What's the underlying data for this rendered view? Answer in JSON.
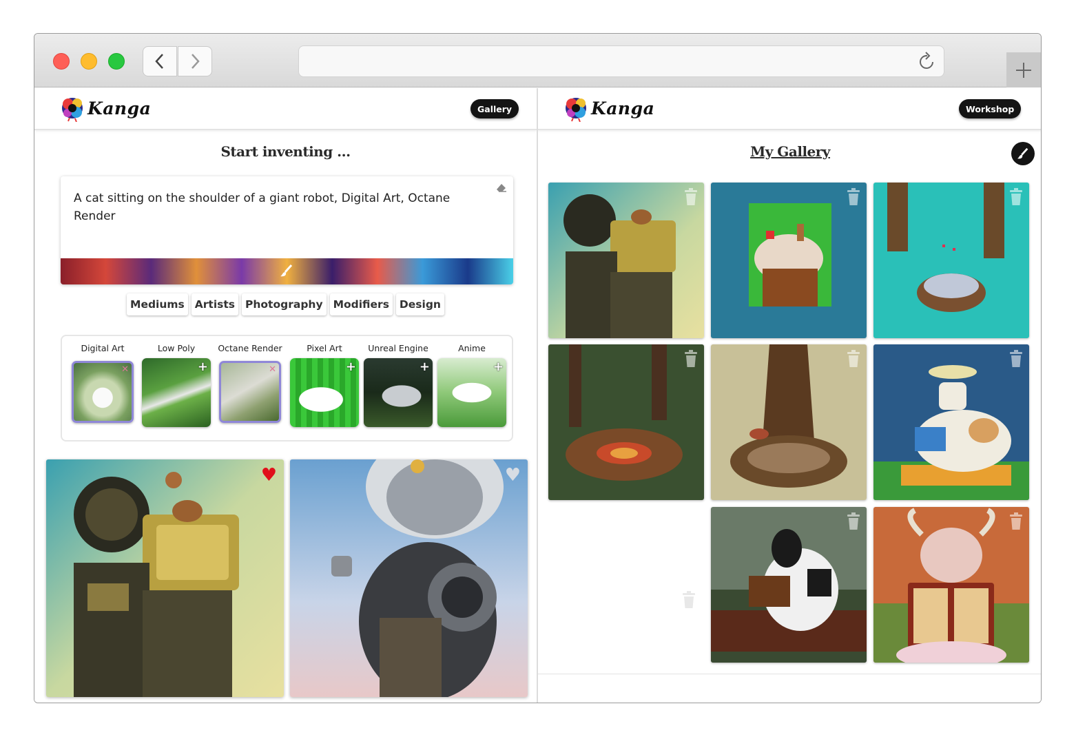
{
  "browser": {
    "url": "",
    "icons": [
      "chevron-left-icon",
      "chevron-right-icon",
      "reload-icon",
      "plus-icon"
    ]
  },
  "workshop": {
    "logo_text": "Kanga",
    "nav_button": "Gallery",
    "heading": "Start inventing ...",
    "prompt": "A cat sitting on the shoulder of a giant robot, Digital Art, Octane Render",
    "tabs": [
      "Mediums",
      "Artists",
      "Photography",
      "Modifiers",
      "Design"
    ],
    "styles": [
      {
        "label": "Digital Art",
        "selected": true
      },
      {
        "label": "Low Poly",
        "selected": false
      },
      {
        "label": "Octane Render",
        "selected": true
      },
      {
        "label": "Pixel Art",
        "selected": false
      },
      {
        "label": "Unreal Engine",
        "selected": false
      },
      {
        "label": "Anime",
        "selected": false
      }
    ],
    "results": [
      {
        "subject": "squirrel-on-robot",
        "liked": true
      },
      {
        "subject": "cat-astronaut",
        "liked": false
      }
    ]
  },
  "gallery": {
    "logo_text": "Kanga",
    "nav_button": "Workshop",
    "heading": "My Gallery",
    "items": [
      "squirrel on giant robot",
      "pixel art tree stump",
      "pixel forest stump with cards",
      "forest card table",
      "tree roots with cards",
      "cow reading on bench",
      "cow reading on couch",
      "bull reading book"
    ]
  },
  "colors": {
    "accent_selected": "#8f87d8",
    "pill_bg": "#141414",
    "heart_liked": "#e0101a"
  }
}
